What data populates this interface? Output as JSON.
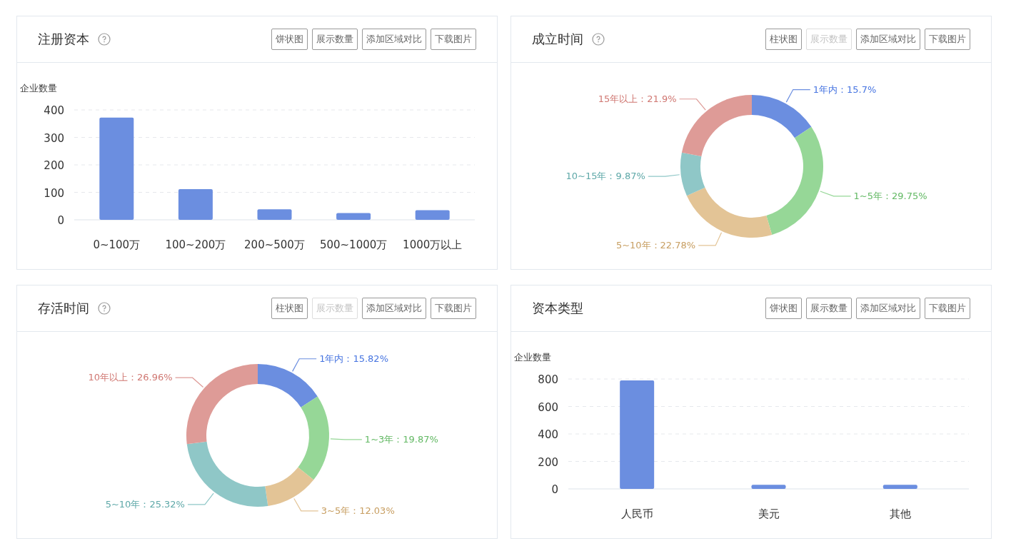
{
  "cards": [
    {
      "title": "注册资本",
      "help": true,
      "buttons": [
        {
          "label": "饼状图",
          "disabled": false
        },
        {
          "label": "展示数量",
          "disabled": false
        },
        {
          "label": "添加区域对比",
          "disabled": false
        },
        {
          "label": "下载图片",
          "disabled": false
        }
      ],
      "chart_data": {
        "type": "bar",
        "ylabel": "企业数量",
        "grid": true,
        "categories": [
          "0~100万",
          "100~200万",
          "200~500万",
          "500~1000万",
          "1000万以上"
        ],
        "series": [
          {
            "color": "#6b8ee0",
            "values": [
              372,
              112,
              38,
              25,
              35
            ]
          }
        ],
        "ylim": [
          0,
          400
        ],
        "yticks": [
          0,
          100,
          200,
          300,
          400
        ]
      }
    },
    {
      "title": "成立时间",
      "help": true,
      "buttons": [
        {
          "label": "柱状图",
          "disabled": false
        },
        {
          "label": "展示数量",
          "disabled": true
        },
        {
          "label": "添加区域对比",
          "disabled": false
        },
        {
          "label": "下载图片",
          "disabled": false
        }
      ],
      "chart_data": {
        "type": "donut",
        "values": [
          15.7,
          29.75,
          22.78,
          9.87,
          21.9
        ],
        "colors": [
          "#6b8ee0",
          "#96d797",
          "#e3c496",
          "#8fc7c7",
          "#de9b97"
        ],
        "value_labels": [
          "1年内：15.7%",
          "1~5年：29.75%",
          "5~10年：22.78%",
          "10~15年：9.87%",
          "15年以上：21.9%"
        ]
      }
    },
    {
      "title": "存活时间",
      "help": true,
      "buttons": [
        {
          "label": "柱状图",
          "disabled": false
        },
        {
          "label": "展示数量",
          "disabled": true
        },
        {
          "label": "添加区域对比",
          "disabled": false
        },
        {
          "label": "下载图片",
          "disabled": false
        }
      ],
      "chart_data": {
        "type": "donut",
        "values": [
          15.82,
          19.87,
          12.03,
          25.32,
          26.96
        ],
        "colors": [
          "#6b8ee0",
          "#96d797",
          "#e3c496",
          "#8fc7c7",
          "#de9b97"
        ],
        "value_labels": [
          "1年内：15.82%",
          "1~3年：19.87%",
          "3~5年：12.03%",
          "5~10年：25.32%",
          "10年以上：26.96%"
        ]
      }
    },
    {
      "title": "资本类型",
      "help": false,
      "buttons": [
        {
          "label": "饼状图",
          "disabled": false
        },
        {
          "label": "展示数量",
          "disabled": false
        },
        {
          "label": "添加区域对比",
          "disabled": false
        },
        {
          "label": "下载图片",
          "disabled": false
        }
      ],
      "chart_data": {
        "type": "bar",
        "ylabel": "企业数量",
        "grid": true,
        "categories": [
          "人民币",
          "美元",
          "其他"
        ],
        "series": [
          {
            "color": "#6b8ee0",
            "values": [
              790,
              30,
              30
            ]
          }
        ],
        "ylim": [
          0,
          800
        ],
        "yticks": [
          0,
          200,
          400,
          600,
          800
        ]
      }
    }
  ]
}
